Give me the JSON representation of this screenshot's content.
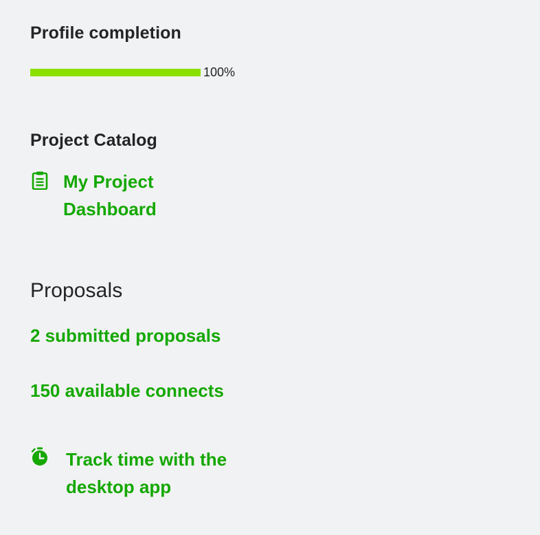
{
  "profile": {
    "title": "Profile completion",
    "progress_fraction": 1.0,
    "progress_label": "100%"
  },
  "catalog": {
    "title": "Project Catalog",
    "dashboard_link_line1": "My Project",
    "dashboard_link_line2": "Dashboard",
    "icon": "clipboard-icon"
  },
  "proposals": {
    "title": "Proposals",
    "submitted_link": "2 submitted proposals",
    "connects_link": "150 available connects"
  },
  "track_time": {
    "line1": "Track time with the",
    "line2": "desktop app",
    "icon": "stopwatch-icon"
  },
  "colors": {
    "accent": "#14a800",
    "progress": "#8ae000",
    "background": "#f1f2f4"
  }
}
